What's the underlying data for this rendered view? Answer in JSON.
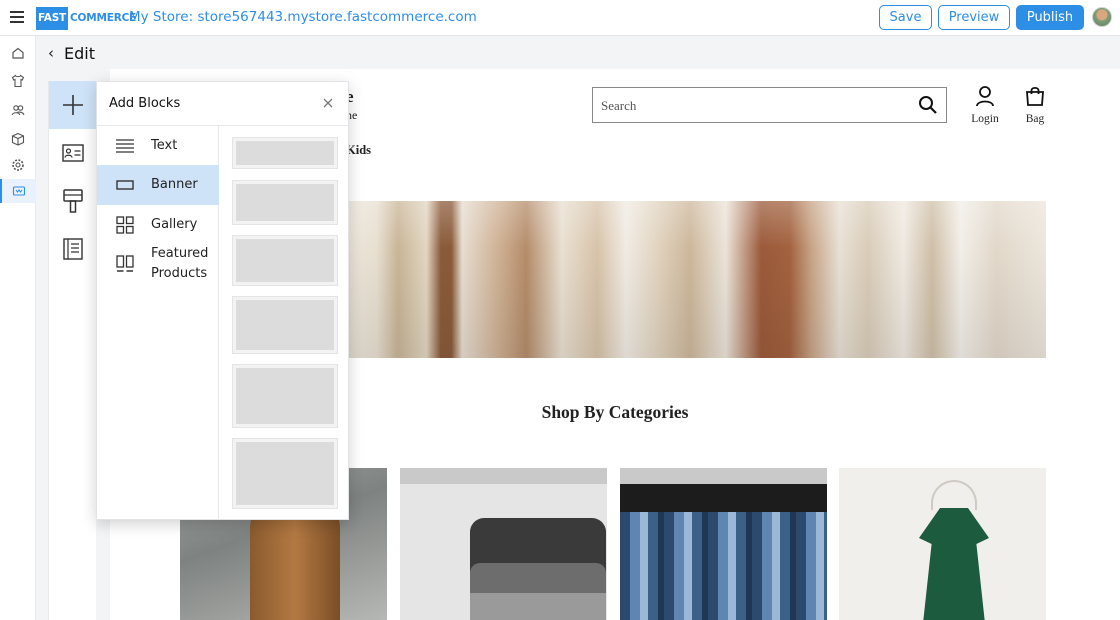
{
  "app": {
    "logo_part1": "FAST",
    "logo_part2": "COMMERCE",
    "store_label": "My Store: store567443.mystore.fastcommerce.com",
    "save_label": "Save",
    "preview_label": "Preview",
    "publish_label": "Publish",
    "accent_color": "#2d8ee6"
  },
  "rail": {
    "items": [
      "home-icon",
      "shirt-icon",
      "users-icon",
      "box-icon",
      "gear-icon",
      "blocks-icon"
    ],
    "active": "blocks-icon"
  },
  "edit": {
    "back_glyph": "‹",
    "title": "Edit"
  },
  "panel": {
    "title": "Add Blocks",
    "blocks": [
      {
        "label": "Text",
        "icon": "text-lines-icon"
      },
      {
        "label": "Banner",
        "icon": "banner-icon"
      },
      {
        "label": "Gallery",
        "icon": "gallery-icon"
      },
      {
        "label": "Featured Products",
        "icon": "featured-products-icon"
      }
    ],
    "selected_block": "Banner"
  },
  "store": {
    "title_fragment": "e",
    "subtitle_fragment": "ne",
    "nav_fragment": "Kids",
    "search_placeholder": "Search",
    "login_label": "Login",
    "bag_label": "Bag",
    "section_title": "Shop By Categories"
  }
}
